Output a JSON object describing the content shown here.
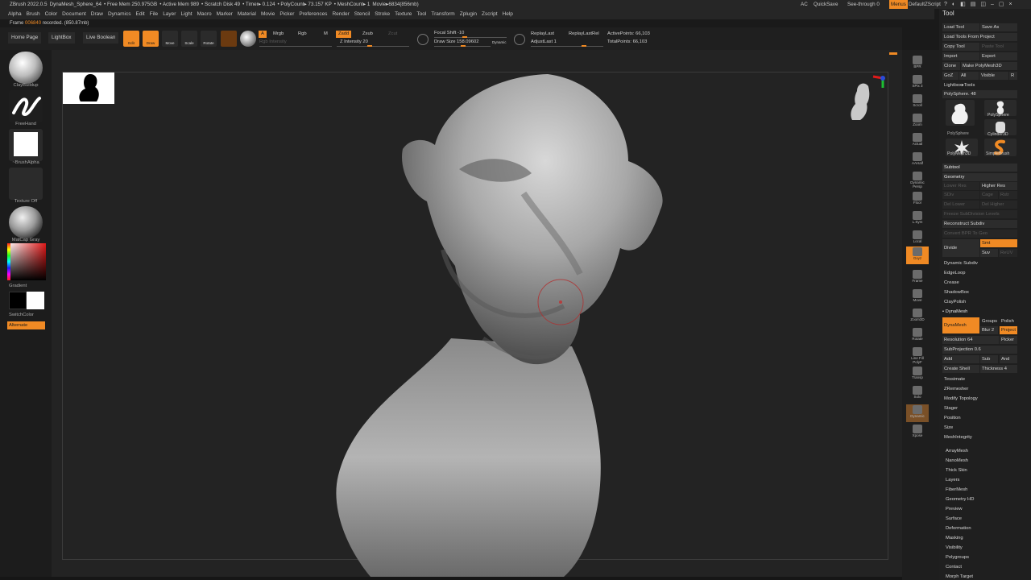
{
  "window": {
    "title_items": [
      "ZBrush 2022.0.5",
      "DynaMesh_Sphere_64",
      "• Free Mem 250.975GB",
      "• Active Mem 989",
      "• Scratch Disk 49",
      "• Timer▸ 0.124",
      "• PolyCount▸ 73.157 KP",
      "• MeshCount▸ 1",
      "Movie▸6834(856mb)"
    ],
    "right_items": {
      "ac": "AC",
      "quicksave": "QuickSave",
      "seethrough": "See-through  0",
      "menus": "Menus",
      "defaultscript": "DefaultZScript"
    }
  },
  "menu": [
    "Alpha",
    "Brush",
    "Color",
    "Document",
    "Draw",
    "Dynamics",
    "Edit",
    "File",
    "Layer",
    "Light",
    "Macro",
    "Marker",
    "Material",
    "Movie",
    "Picker",
    "Preferences",
    "Render",
    "Stencil",
    "Stroke",
    "Texture",
    "Tool",
    "Transform",
    "Zplugin",
    "Zscript",
    "Help"
  ],
  "frame_status": {
    "prefix": "Frame",
    "frame_num": "006840",
    "suffix": "recorded. (850.87mb)"
  },
  "shelf": {
    "home_page": "Home Page",
    "lightbox": "LightBox",
    "live_boolean": "Live Boolean",
    "tools": [
      {
        "label": "Edit",
        "active": true
      },
      {
        "label": "Draw",
        "active": true
      },
      {
        "label": "Move",
        "active": false
      },
      {
        "label": "Scale",
        "active": false
      },
      {
        "label": "Rotate",
        "active": false
      }
    ],
    "a_btn": "A",
    "mrgb": "Mrgb",
    "rgb": "Rgb",
    "m": "M",
    "zadd": "Zadd",
    "zsub": "Zsub",
    "zcut": "Zcut",
    "rgb_intensity": "Rgb Intensity",
    "z_intensity": "Z Intensity 20",
    "focal_shift": "Focal Shift -10",
    "draw_size": "Draw Size 158.09602",
    "dynamic": "Dynamic",
    "replay_last": "ReplayLast",
    "replay_last_rel": "ReplayLastRel",
    "adjust_last": "AdjustLast 1",
    "active_points": "ActivePoints: 66,103",
    "total_points": "TotalPoints: 66,103"
  },
  "left_panel": {
    "brush": "ClayBuildup",
    "stroke": "FreeHand",
    "alpha": "~BrushAlpha",
    "texture": "Texture Off",
    "material": "MatCap Gray",
    "gradient": "Gradient",
    "switch_color": "SwitchColor",
    "alternate": "Alternate",
    "colors": {
      "main": "#ffffff",
      "secondary": "#000000"
    }
  },
  "right_strip": [
    "BPR",
    "SPix 3",
    "Scroll",
    "Zoom",
    "Actual",
    "AAHalf",
    "Dynamic Persp",
    "Floor",
    "L.Sym",
    "Local",
    "Gxyz",
    "Frame",
    "Move",
    "Zoom3D",
    "Rotate",
    "Line Fill PolyF",
    "Transp",
    "Solo",
    "Dynamic",
    "Xpose"
  ],
  "tool": {
    "title": "Tool",
    "load_tool": "Load Tool",
    "save_as": "Save As",
    "load_from_project": "Load Tools From Project",
    "copy_tool": "Copy Tool",
    "paste_tool": "Paste Tool",
    "import": "Import",
    "export": "Export",
    "clone": "Clone",
    "make_polymesh": "Make PolyMesh3D",
    "goz": "GoZ",
    "all": "All",
    "visible": "Visible",
    "r": "R",
    "lightbox_tools": "Lightbox▸Tools",
    "polysphere_slider": "PolySphere. 48",
    "thumbs": [
      "PolySphere",
      "PolySphere",
      "Cylinder3D",
      "PolyMesh3D",
      "SimpleBrush"
    ],
    "subtool": "Subtool",
    "geometry": "Geometry",
    "lower_res": "Lower Res",
    "higher_res": "Higher Res",
    "sdiv": "SDiv",
    "cage": "Cage",
    "rstr": "Rstr",
    "del_lower": "Del Lower",
    "del_higher": "Del Higher",
    "freeze_subdiv": "Freeze SubDivision Levels",
    "reconstruct_subdiv": "Reconstruct Subdiv",
    "convert_bpr": "Convert BPR To Geo",
    "divide": "Divide",
    "smt": "Smt",
    "suv": "Suv",
    "reuv": "ReUV",
    "dynamic_subdiv": "Dynamic Subdiv",
    "edgeloop": "EdgeLoop",
    "crease": "Crease",
    "shadowbox": "ShadowBox",
    "claypolish": "ClayPolish",
    "dynamesh_header": "• DynaMesh",
    "dynamesh_btn": "DynaMesh",
    "groups": "Groups",
    "polish": "Polish",
    "blur": "Blur 2",
    "project": "Project",
    "resolution": "Resolution 64",
    "picker": "Picker",
    "subprojection": "SubProjection 0.6",
    "add": "Add",
    "sub": "Sub",
    "and": "And",
    "create_shell": "Create Shell",
    "thickness": "Thickness 4",
    "tessimate": "Tessimate",
    "zremesher": "ZRemesher",
    "modify_topology": "Modify Topology",
    "stager": "Stager",
    "position": "Position",
    "size": "Size",
    "meshintegrity": "MeshIntegrity",
    "subpalettes": [
      "ArrayMesh",
      "NanoMesh",
      "Thick Skin",
      "Layers",
      "FiberMesh",
      "Geometry HD",
      "Preview",
      "Surface",
      "Deformation",
      "Masking",
      "Visibility",
      "Polygroups",
      "Contact",
      "Morph Target"
    ]
  }
}
